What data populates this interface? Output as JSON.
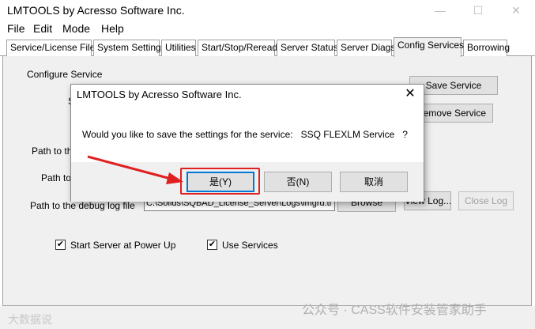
{
  "window": {
    "title": "LMTOOLS by Acresso Software Inc.",
    "controls": [
      "—",
      "☐",
      "✕"
    ]
  },
  "menu": [
    "File",
    "Edit",
    "Mode",
    "Help"
  ],
  "tabs": [
    "Service/License File",
    "System Settings",
    "Utilities",
    "Start/Stop/Reread",
    "Server Status",
    "Server Diags",
    "Config Services",
    "Borrowing"
  ],
  "panel": {
    "configure_service": "Configure Service",
    "service_name_label_partial": "S",
    "path_lmgrd_label": "Path to the",
    "path_license_label": "Path to t",
    "path_debug_label": "Path to the debug log file",
    "debug_path_value": "C:\\Solids\\SQBAD_License_Server\\Logs\\lmgrd.tl",
    "save_service": "Save Service",
    "remove_service": "Remove Service",
    "browse": "Browse",
    "view_log": "View Log...",
    "close_log": "Close Log",
    "start_at_power_up": "Start Server at Power Up",
    "use_services": "Use Services",
    "start_at_power_up_checked": "✔",
    "use_services_checked": "✔"
  },
  "dialog": {
    "title": "LMTOOLS by Acresso Software Inc.",
    "close": "✕",
    "message": "Would you like to save the settings for the service:   SSQ FLEXLM Service   ?",
    "yes": "是(Y)",
    "no": "否(N)",
    "cancel": "取消"
  },
  "watermark": {
    "right": "公众号 · CASS软件安装管家助手",
    "left": "大数据说"
  },
  "colors": {
    "accent": "#0078d7",
    "highlight": "#e02020"
  }
}
